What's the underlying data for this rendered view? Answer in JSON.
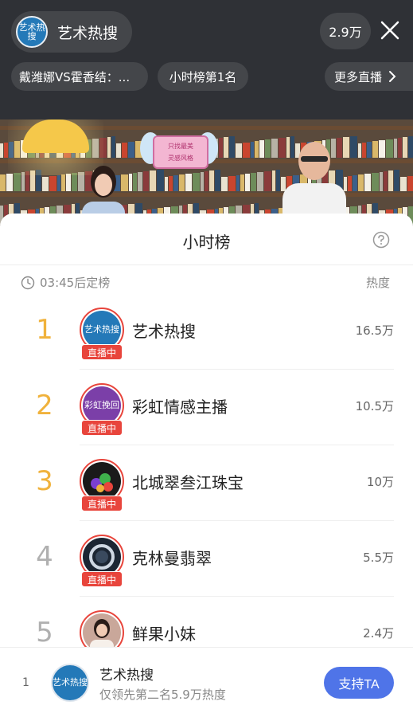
{
  "header": {
    "host_avatar_text": "艺术热搜",
    "host_name": "艺术热搜",
    "viewer_count": "2.9万",
    "close_icon": "close-icon",
    "chips": [
      {
        "label": "戴潍娜VS霍香结：..."
      },
      {
        "label": "小时榜第1名"
      },
      {
        "label": "更多直播",
        "icon": "chevron-right-icon"
      }
    ]
  },
  "video": {
    "sign_text_1": "只找最美",
    "sign_text_2": "灵感风格"
  },
  "sheet": {
    "title": "小时榜",
    "help_icon": "question-circle-icon",
    "countdown": "03:45后定榜",
    "heat_header": "热度",
    "live_label": "直播中",
    "rows": [
      {
        "rank": "1",
        "name": "艺术热搜",
        "heat": "16.5万",
        "avatar_text": "艺术热搜",
        "avatar_color": "#2479b8",
        "live": true
      },
      {
        "rank": "2",
        "name": "彩虹情感主播",
        "heat": "10.5万",
        "avatar_text": "彩虹挽回",
        "avatar_color": "#7b3fa8",
        "live": true
      },
      {
        "rank": "3",
        "name": "北城翠叁江珠宝",
        "heat": "10万",
        "avatar_text": "",
        "avatar_color": "#1a1a1a",
        "live": true
      },
      {
        "rank": "4",
        "name": "克林曼翡翠",
        "heat": "5.5万",
        "avatar_text": "",
        "avatar_color": "#1c2633",
        "live": true
      },
      {
        "rank": "5",
        "name": "鲜果小妹",
        "heat": "2.4万",
        "avatar_text": "",
        "avatar_color": "#c9a79a",
        "live": false
      }
    ]
  },
  "footer": {
    "rank": "1",
    "avatar_text": "艺术热搜",
    "name": "艺术热搜",
    "subtitle": "仅领先第二名5.9万热度",
    "support_label": "支持TA"
  },
  "colors": {
    "accent_blue": "#4f74e8",
    "live_red": "#e8453c",
    "rank_gold": "#f0b23c",
    "rank_gray": "#b0b0b0"
  }
}
